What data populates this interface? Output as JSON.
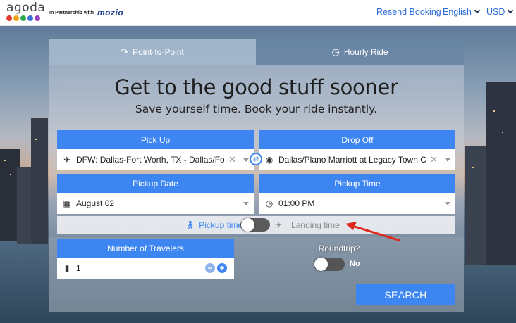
{
  "header": {
    "logo_text": "agoda",
    "logo_dot_colors": [
      "#e23a2e",
      "#f0a31a",
      "#2fa84f",
      "#3b6fd8",
      "#9b44c1"
    ],
    "partner_text": "In Partnership with",
    "partner_brand": "mozio",
    "resend_label": "Resend Booking",
    "language_label": "English",
    "currency_label": "USD"
  },
  "tabs": [
    {
      "label": "Point-to-Point",
      "icon": "route-icon",
      "active": true
    },
    {
      "label": "Hourly Ride",
      "icon": "clock-icon",
      "active": false
    }
  ],
  "hero": {
    "title": "Get to the good stuff sooner",
    "subtitle": "Save yourself time. Book your ride instantly."
  },
  "form": {
    "pickup_label": "Pick Up",
    "pickup_value": "DFW: Dallas-Fort Worth, TX - Dallas/Fort Wo",
    "dropoff_label": "Drop Off",
    "dropoff_value": "Dallas/Plano Marriott at Legacy Town Cente",
    "date_label": "Pickup Date",
    "date_value": "August 02",
    "time_label": "Pickup Time",
    "time_value": "01:00 PM",
    "pickup_time_option": "Pickup time",
    "landing_time_option": "Landing time",
    "travelers_label": "Number of Travelers",
    "travelers_value": "1",
    "roundtrip_label": "Roundtrip?",
    "roundtrip_value": "No",
    "search_label": "SEARCH"
  },
  "colors": {
    "accent": "#3d86f2",
    "link": "#2e6bd9",
    "annotation_arrow": "#e0281c"
  }
}
